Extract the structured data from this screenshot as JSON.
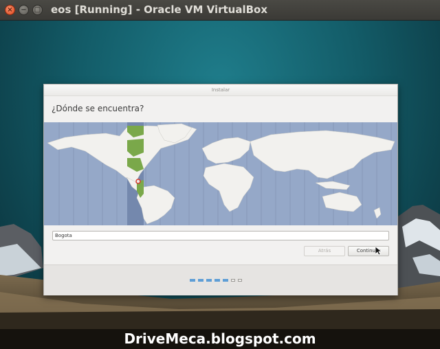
{
  "window": {
    "title": "eos [Running] - Oracle VM VirtualBox",
    "close_glyph": "×",
    "minimize_glyph": "−",
    "maximize_glyph": "□"
  },
  "installer": {
    "title": "Instalar",
    "question": "¿Dónde se encuentra?",
    "timezone_input_value": "Bogota",
    "back_label": "Atrás",
    "continue_label": "Continuar",
    "progress": {
      "total_steps": 7,
      "completed_steps": 5
    }
  },
  "watermark": "DriveMeca.blogspot.com",
  "colors": {
    "map_ocean": "#95a8c8",
    "timezone_highlight": "#7aa84a",
    "progress_active": "#5e9ed6",
    "close_button": "#e0461c"
  }
}
